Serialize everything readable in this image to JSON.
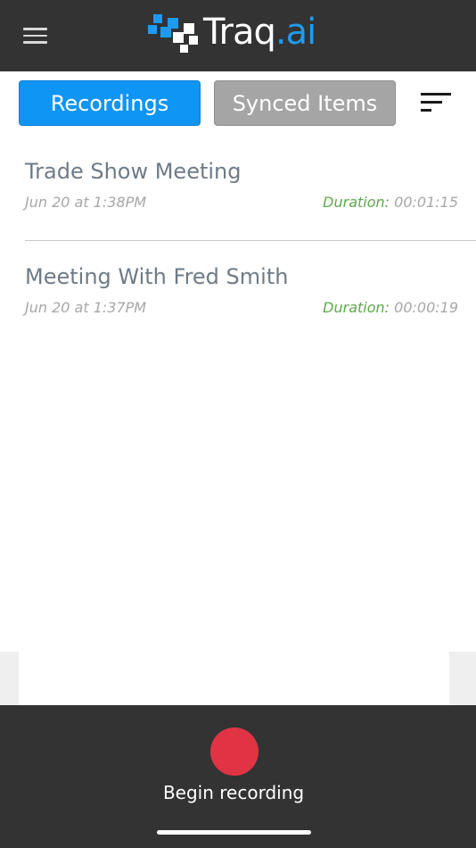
{
  "header": {
    "brand_name_primary": "Traq",
    "brand_name_suffix": ".ai",
    "brand_accent_color": "#1e9bf0"
  },
  "tabs": [
    {
      "label": "Recordings",
      "active": true
    },
    {
      "label": "Synced Items",
      "active": false
    }
  ],
  "recordings": [
    {
      "title": "Trade Show Meeting",
      "date": "Jun 20 at 1:38PM",
      "duration_label": "Duration:",
      "duration": "00:01:15"
    },
    {
      "title": "Meeting With Fred Smith",
      "date": "Jun 20 at 1:37PM",
      "duration_label": "Duration:",
      "duration": "00:00:19"
    }
  ],
  "footer": {
    "record_label": "Begin recording",
    "record_color": "#e03444"
  },
  "icons": {
    "menu": "hamburger-icon",
    "sort": "sort-icon",
    "record": "record-dot-icon"
  }
}
